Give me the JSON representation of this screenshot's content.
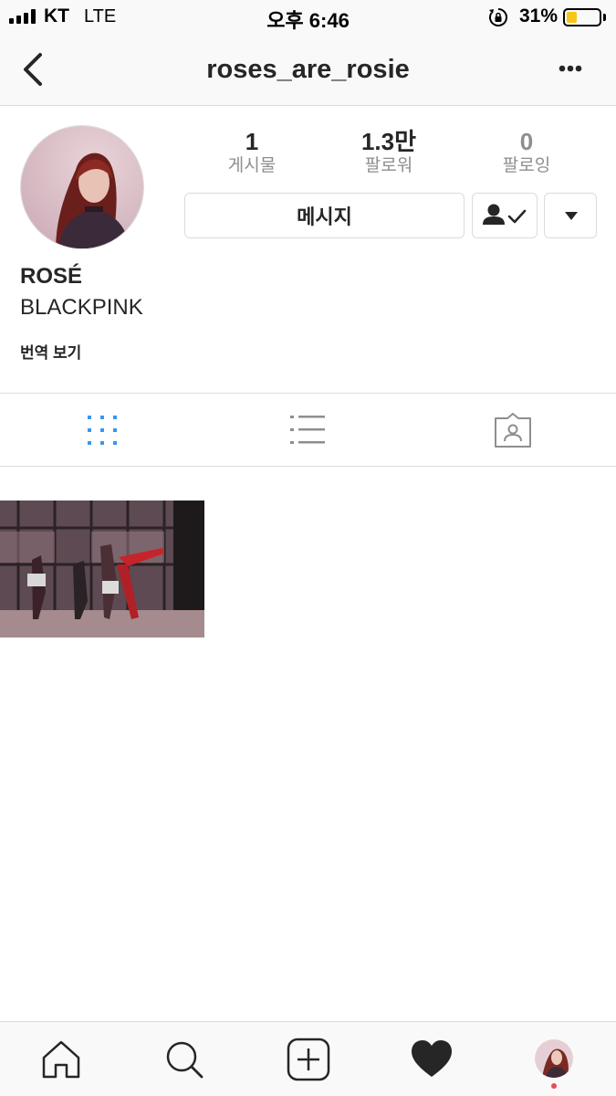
{
  "status_bar": {
    "carrier": "KT",
    "network": "LTE",
    "time": "오후 6:46",
    "battery_percent": "31%",
    "battery_level": 0.31,
    "icons": [
      "signal-icon",
      "rotation-lock-icon",
      "battery-icon"
    ]
  },
  "nav": {
    "username": "roses_are_rosie",
    "icons": [
      "back-icon",
      "more-icon"
    ]
  },
  "profile": {
    "stats": [
      {
        "value": "1",
        "label": "게시물"
      },
      {
        "value": "1.3만",
        "label": "팔로워"
      },
      {
        "value": "0",
        "label": "팔로잉"
      }
    ],
    "message_label": "메시지",
    "name": "ROSÉ",
    "bio": "BLACKPINK",
    "translate_label": "번역 보기"
  },
  "tabs": [
    {
      "icon": "grid-icon",
      "active": true
    },
    {
      "icon": "list-icon",
      "active": false
    },
    {
      "icon": "tagged-icon",
      "active": false
    }
  ],
  "posts_count": 1,
  "bottom_nav": {
    "icons": [
      "home-icon",
      "search-icon",
      "add-icon",
      "heart-icon",
      "profile-avatar"
    ]
  },
  "colors": {
    "active_tab": "#3897f0",
    "inactive_icon": "#8e8e8e",
    "notification_dot": "#ed4956",
    "battery_fill": "#f5c518"
  }
}
